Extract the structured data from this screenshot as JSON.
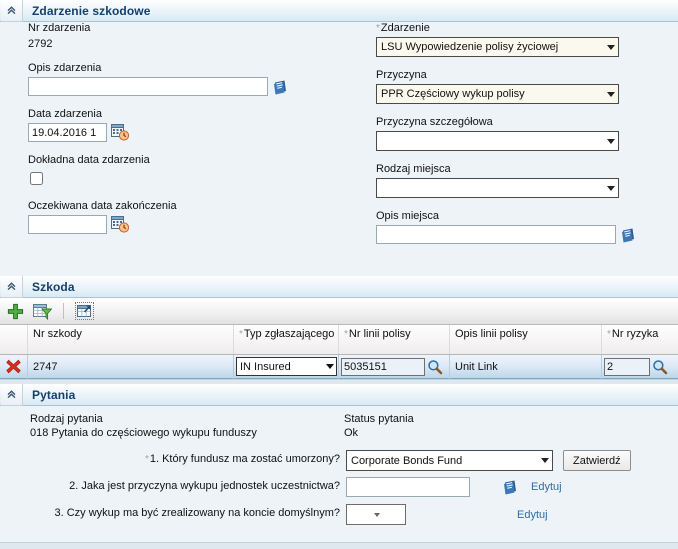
{
  "sections": {
    "zdarzenie": {
      "title": "Zdarzenie szkodowe",
      "collapse_icon": "chevron-double-up-icon",
      "fields": {
        "nr_zdarzenia_label": "Nr zdarzenia",
        "nr_zdarzenia_value": "2792",
        "opis_zdarzenia_label": "Opis zdarzenia",
        "opis_zdarzenia_value": "",
        "opis_zdarzenia_icon": "notepad-icon",
        "data_zdarzenia_label": "Data zdarzenia",
        "data_zdarzenia_value": "19.04.2016 1",
        "data_zdarzenia_icon": "calendar-clock-icon",
        "dokladna_data_label": "Dokładna data zdarzenia",
        "dokladna_data_checked": false,
        "oczekiwana_data_label": "Oczekiwana data zakończenia",
        "oczekiwana_data_value": "",
        "oczekiwana_data_icon": "calendar-clock-icon",
        "zdarzenie_label": "Zdarzenie",
        "zdarzenie_required": "*",
        "zdarzenie_value": "LSU Wypowiedzenie polisy życiowej",
        "przyczyna_label": "Przyczyna",
        "przyczyna_value": "PPR Częściowy wykup polisy",
        "przyczyna_szcz_label": "Przyczyna szczegółowa",
        "przyczyna_szcz_value": "",
        "rodzaj_miejsca_label": "Rodzaj miejsca",
        "rodzaj_miejsca_value": "",
        "opis_miejsca_label": "Opis miejsca",
        "opis_miejsca_value": "",
        "opis_miejsca_icon": "notepad-icon"
      }
    },
    "szkoda": {
      "title": "Szkoda",
      "collapse_icon": "chevron-double-up-icon",
      "toolbar": [
        {
          "name": "add-row-button",
          "icon": "green-plus-icon"
        },
        {
          "name": "filter-table-button",
          "icon": "table-filter-icon"
        },
        {
          "name": "export-table-button",
          "icon": "table-export-icon"
        }
      ],
      "columns": [
        {
          "label": "",
          "required": ""
        },
        {
          "label": "Nr szkody",
          "required": ""
        },
        {
          "label": "Typ zgłaszającego",
          "required": "*"
        },
        {
          "label": "Nr linii polisy",
          "required": "*"
        },
        {
          "label": "Opis linii polisy",
          "required": ""
        },
        {
          "label": "Nr ryzyka",
          "required": "*"
        }
      ],
      "rows": [
        {
          "delete_icon": "red-x-icon",
          "nr_szkody": "2747",
          "typ_zglaszajacego": "IN Insured",
          "nr_linii_polisy": "5035151",
          "nr_linii_search_icon": "magnifier-icon",
          "opis_linii_polisy": "Unit Link",
          "nr_ryzyka": "2",
          "nr_ryzyka_search_icon": "magnifier-icon"
        }
      ]
    },
    "pytania": {
      "title": "Pytania",
      "collapse_icon": "chevron-double-up-icon",
      "rodzaj_pytania_label": "Rodzaj pytania",
      "rodzaj_pytania_value": "018 Pytania do częściowego wykupu funduszy",
      "status_pytania_label": "Status pytania",
      "status_pytania_value": "Ok",
      "questions": [
        {
          "required": "*",
          "text": "1. Który fundusz ma zostać umorzony?",
          "control": "select",
          "value": "Corporate Bonds Fund",
          "action_label": "Zatwierdź",
          "action_type": "button"
        },
        {
          "required": "",
          "text": "2. Jaka jest przyczyna wykupu jednostek uczestnictwa?",
          "control": "text",
          "value": "",
          "icon": "notepad-icon",
          "action_label": "Edytuj",
          "action_type": "link"
        },
        {
          "required": "",
          "text": "3. Czy wykup ma być zrealizowany na koncie domyślnym?",
          "control": "small-select",
          "value": "",
          "action_label": "Edytuj",
          "action_type": "link"
        }
      ]
    }
  },
  "colors": {
    "header_title": "#13406b",
    "panel_bg": "#eef3f7",
    "link": "#2e6da4",
    "required_asterisk": "#93a7b5",
    "row_selected": "#bcd7ea",
    "delete_icon": "#d52b1e",
    "add_icon": "#3d9b35"
  }
}
